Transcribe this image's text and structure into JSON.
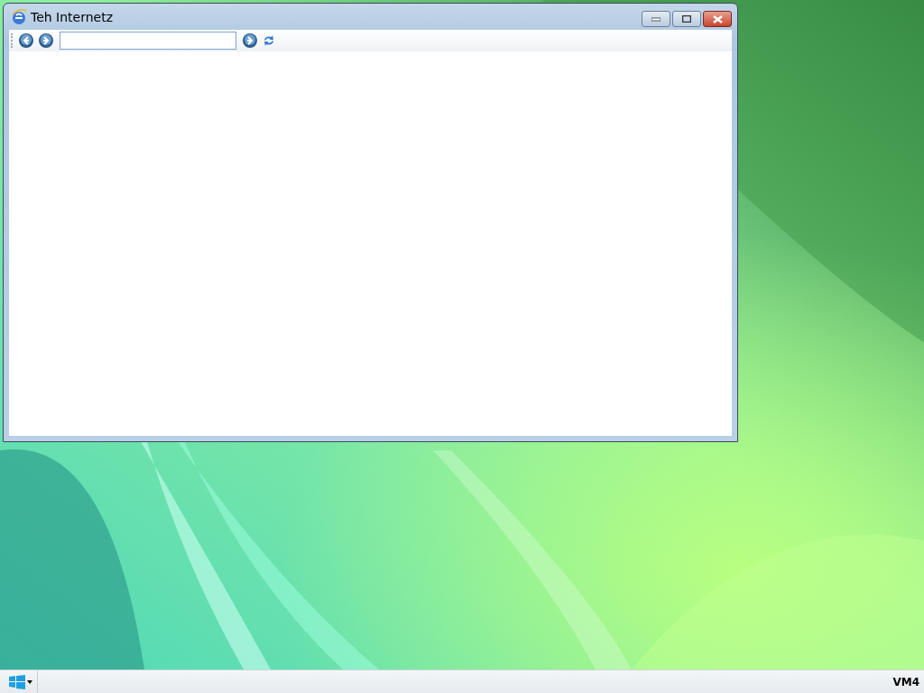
{
  "window": {
    "title": "Teh Internetz"
  },
  "taskbar": {
    "tray_label": "VM4"
  }
}
